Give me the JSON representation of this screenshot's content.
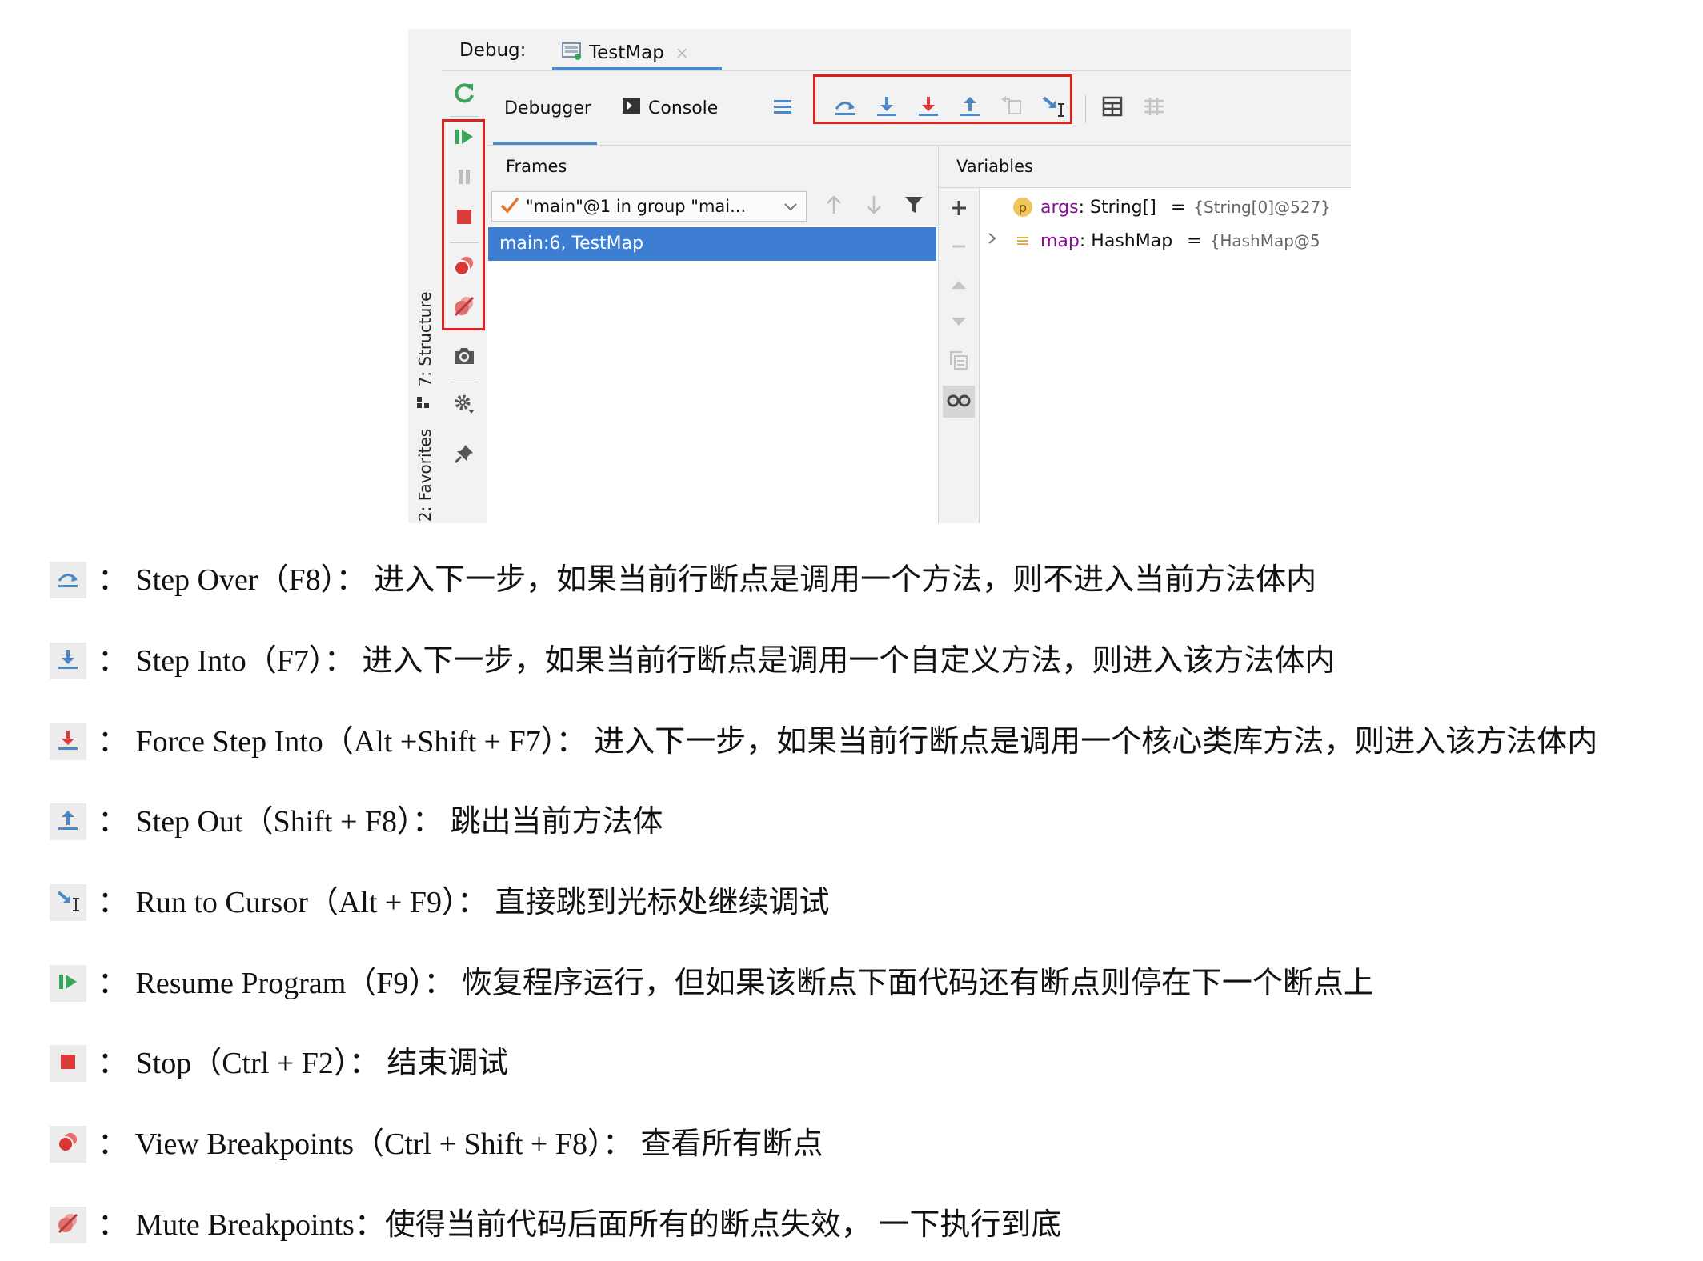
{
  "ide": {
    "side_tabs": {
      "structure": "7: Structure",
      "favorites": "2: Favorites"
    },
    "debug_label": "Debug:",
    "tab_title": "TestMap",
    "tab_close": "×",
    "subtabs": {
      "debugger": "Debugger",
      "console": "Console"
    },
    "frames": {
      "header": "Frames",
      "thread_selector": "\"main\"@1 in group \"mai...",
      "selected_frame": "main:6, TestMap"
    },
    "variables": {
      "header": "Variables",
      "rows": [
        {
          "badge": "p",
          "name": "args",
          "type": ": String[]",
          "eq": "=",
          "value": "{String[0]@527}"
        },
        {
          "badge": "≡",
          "name": "map",
          "type": ": HashMap",
          "eq": "=",
          "value": "{HashMap@5"
        }
      ]
    },
    "colors": {
      "accent": "#4a88c7",
      "selection": "#3d7ed3",
      "highlight_box": "#e01f1f",
      "green": "#3aa55d",
      "red": "#db3b3b"
    }
  },
  "legend": [
    {
      "icon": "step-over-icon",
      "text": "：  Step Over（F8）：  进入下一步，如果当前行断点是调用一个方法，则不进入当前方法体内"
    },
    {
      "icon": "step-into-icon",
      "text": "：  Step Into（F7）：  进入下一步，如果当前行断点是调用一个自定义方法，则进入该方法体内"
    },
    {
      "icon": "force-step-into-icon",
      "text": "：  Force Step Into（Alt +Shift  + F7）：  进入下一步，如果当前行断点是调用一个核心类库方法，则进入该方法体内"
    },
    {
      "icon": "step-out-icon",
      "text": "：  Step Out（Shift  + F8）：  跳出当前方法体"
    },
    {
      "icon": "run-to-cursor-icon",
      "text": "：  Run to Cursor（Alt + F9）：  直接跳到光标处继续调试"
    },
    {
      "icon": "resume-program-icon",
      "text": "：  Resume Program（F9）：  恢复程序运行，但如果该断点下面代码还有断点则停在下一个断点上"
    },
    {
      "icon": "stop-icon",
      "text": "：  Stop（Ctrl + F2）：  结束调试"
    },
    {
      "icon": "view-breakpoints-icon",
      "text": "：  View Breakpoints（Ctrl + Shift  + F8）：  查看所有断点"
    },
    {
      "icon": "mute-breakpoints-icon",
      "text": "：  Mute Breakpoints：使得当前代码后面所有的断点失效，  一下执行到底"
    }
  ]
}
